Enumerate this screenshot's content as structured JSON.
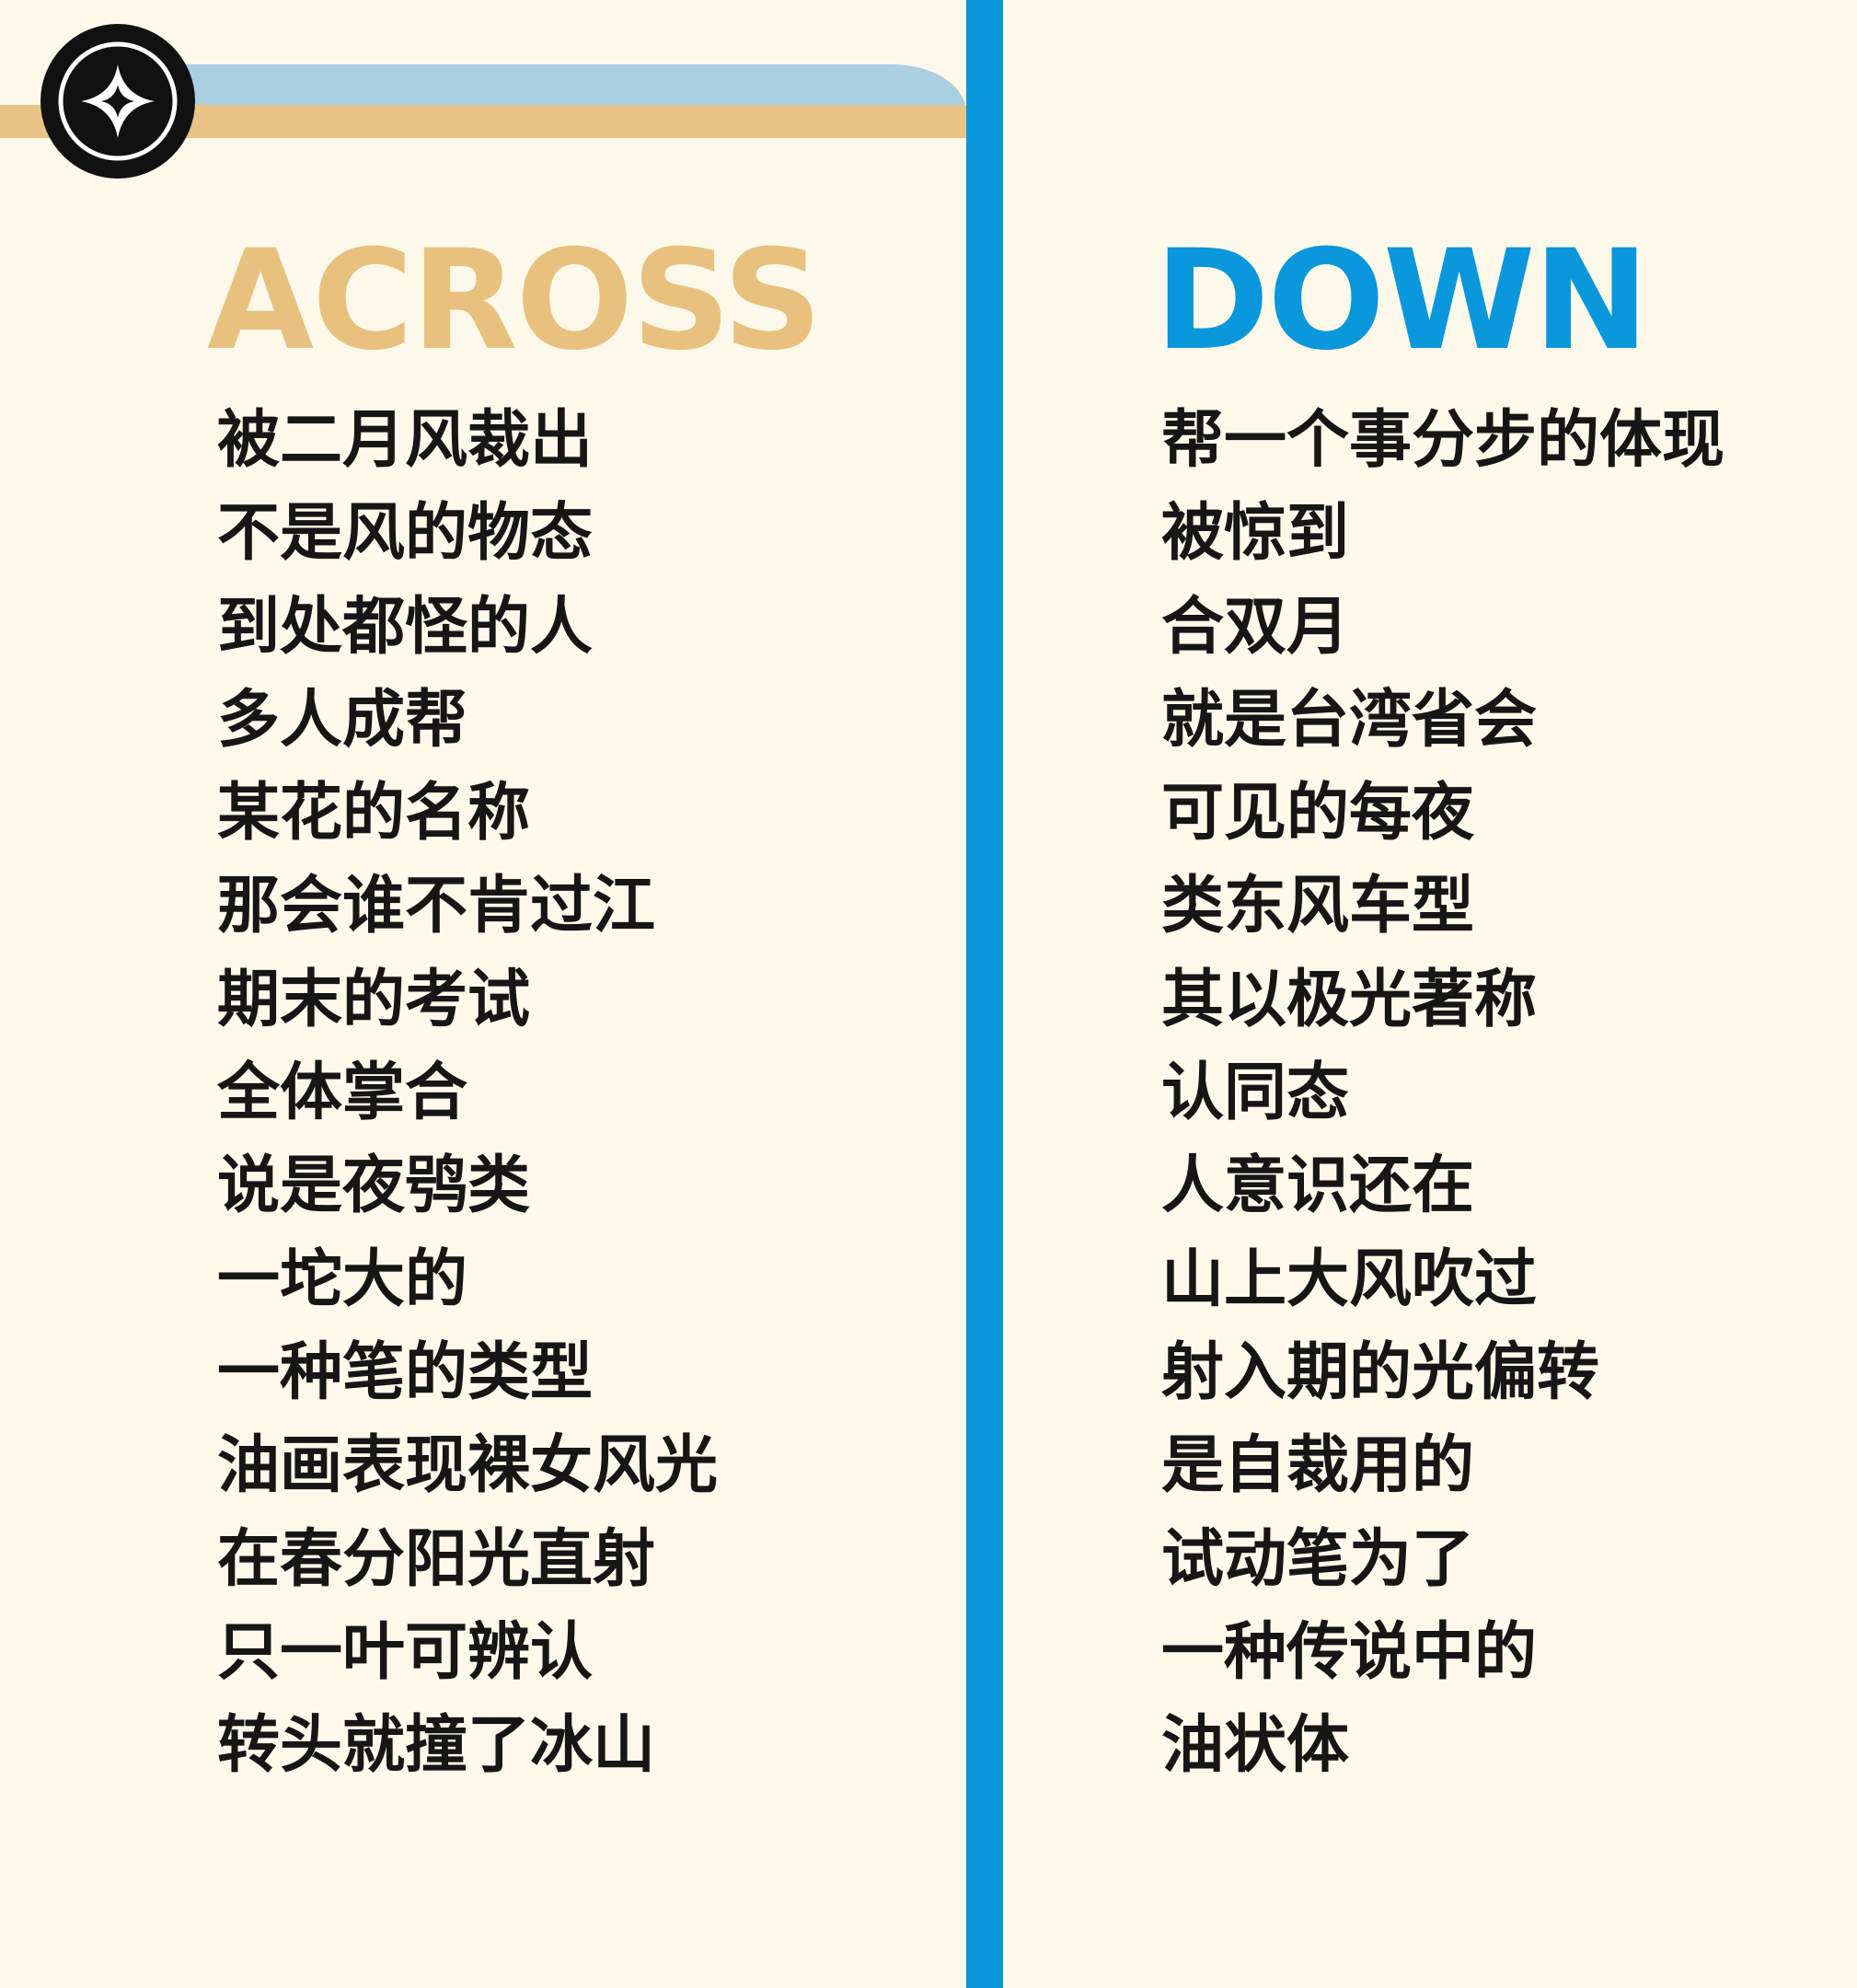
{
  "across": {
    "heading": "ACROSS",
    "clues": [
      "被二月风裁出",
      "不是风的物态",
      "到处都怪的人",
      "多人成帮",
      "某花的名称",
      "那会谁不肯过江",
      "期末的考试",
      "全体掌合",
      "说是夜鸮类",
      "一坨大的",
      "一种笔的类型",
      "油画表现裸女风光",
      "在春分阳光直射",
      "只一叶可辨认",
      "转头就撞了冰山"
    ]
  },
  "down": {
    "heading": "DOWN",
    "clues": [
      "帮一个事分步的体现",
      "被惊到",
      "合双月",
      "就是台湾省会",
      "可见的每夜",
      "类东风车型",
      "其以极光著称",
      "认同态",
      "人意识还在",
      "山上大风吹过",
      "射入期的光偏转",
      "是自裁用的",
      "试动笔为了",
      "一种传说中的",
      "油状体"
    ]
  },
  "icons": {
    "logo": "compass-star-icon"
  },
  "colors": {
    "background": "#fdf9ea",
    "across_heading": "#e8c17f",
    "down_heading": "#0a97dc",
    "divider": "#0a97dc",
    "band_blue": "#a9cfe0",
    "band_tan": "#e8c486",
    "clue_text": "#161616"
  }
}
